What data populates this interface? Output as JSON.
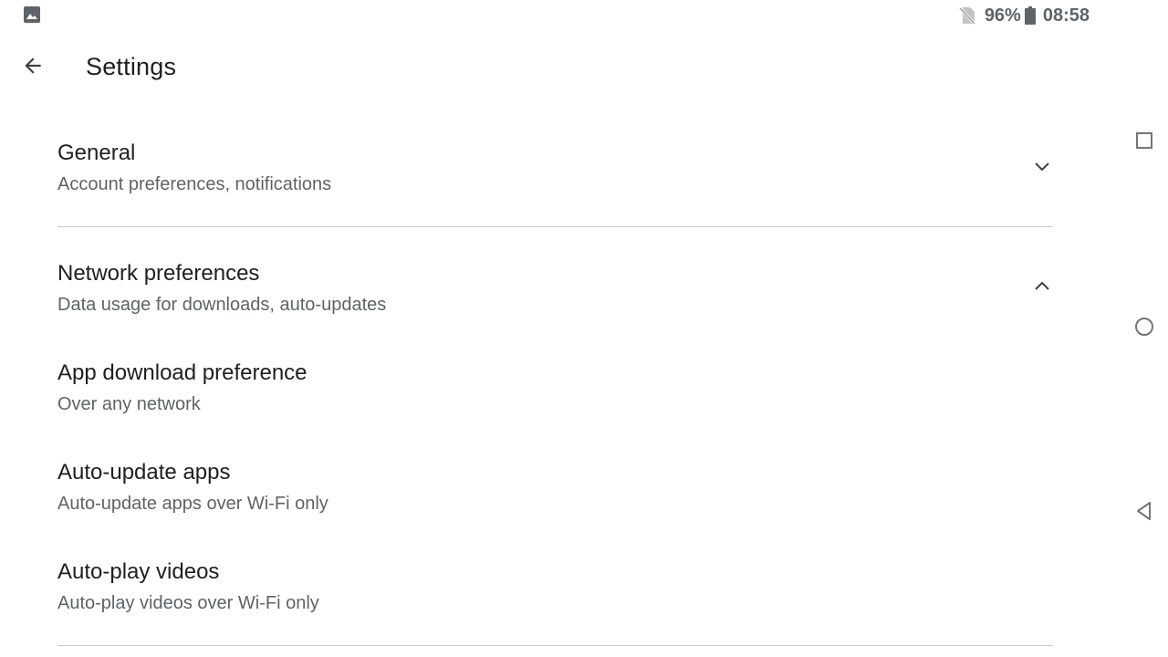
{
  "status_bar": {
    "battery_percent": "96%",
    "time": "08:58",
    "icons": [
      "gallery-icon",
      "no-sim-icon",
      "battery-icon"
    ]
  },
  "app_bar": {
    "title": "Settings",
    "back_icon": "arrow-back-icon"
  },
  "sections": [
    {
      "title": "General",
      "subtitle": "Account preferences, notifications",
      "expanded": false,
      "icon": "chevron-down-icon"
    },
    {
      "title": "Network preferences",
      "subtitle": "Data usage for downloads, auto-updates",
      "expanded": true,
      "icon": "chevron-up-icon",
      "items": [
        {
          "title": "App download preference",
          "subtitle": "Over any network"
        },
        {
          "title": "Auto-update apps",
          "subtitle": "Auto-update apps over Wi-Fi only"
        },
        {
          "title": "Auto-play videos",
          "subtitle": "Auto-play videos over Wi-Fi only"
        }
      ]
    }
  ],
  "nav_bar": {
    "icons": [
      "recents-square-icon",
      "home-circle-icon",
      "back-triangle-icon"
    ]
  },
  "colors": {
    "primary_text": "#1f1f1f",
    "secondary_text": "#5f6368",
    "divider": "#c8c8c8",
    "status_icons": "#5f6368"
  }
}
